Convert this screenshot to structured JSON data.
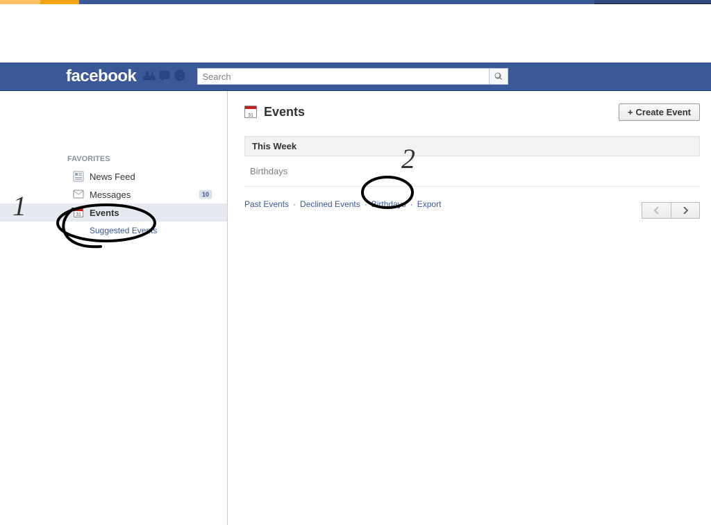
{
  "header": {
    "logo_text": "facebook",
    "search_placeholder": "Search"
  },
  "sidebar": {
    "section_label": "FAVORITES",
    "items": [
      {
        "label": "News Feed",
        "badge": null
      },
      {
        "label": "Messages",
        "badge": "10"
      },
      {
        "label": "Events",
        "badge": null
      },
      {
        "label": "Suggested Events",
        "badge": null
      }
    ]
  },
  "main": {
    "title": "Events",
    "create_button": "Create Event",
    "section_header": "This Week",
    "section_row": "Birthdays",
    "footer_links": [
      "Past Events",
      "Declined Events",
      "Birthdays",
      "Export"
    ]
  },
  "annotations": {
    "num1": "1",
    "num2": "2"
  }
}
